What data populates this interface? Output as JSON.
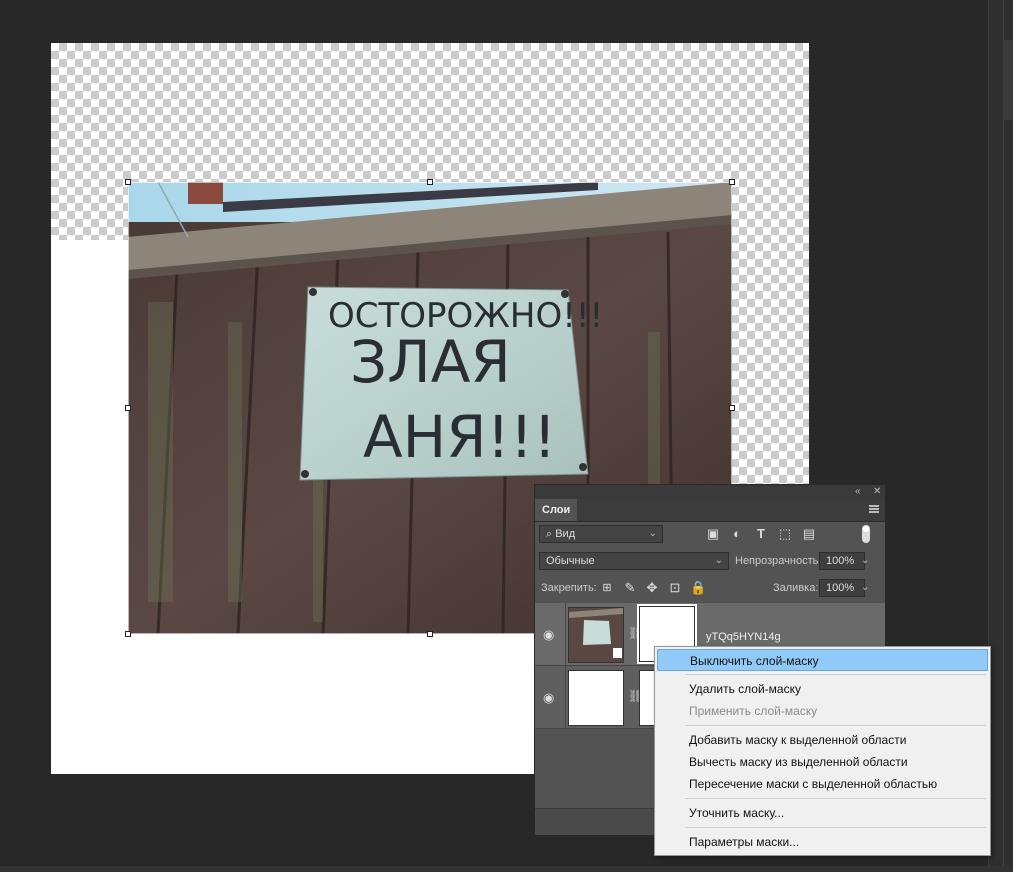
{
  "layers_panel": {
    "tab_label": "Слои",
    "filter": {
      "value": "Вид"
    },
    "blend_mode": "Обычные",
    "opacity_label": "Непрозрачность:",
    "opacity_value": "100%",
    "lock_label": "Закрепить:",
    "fill_label": "Заливка:",
    "fill_value": "100%",
    "layers": [
      {
        "name": "yTQq5HYN14g",
        "has_mask": true,
        "visible": true
      },
      {
        "name": "",
        "has_mask": true,
        "visible": true
      }
    ]
  },
  "photo_sign": {
    "line1": "ОСТОРОЖНО!!!",
    "line2": "ЗЛАЯ",
    "line3": "АНЯ!!!"
  },
  "context_menu": {
    "items": [
      {
        "label": "Выключить слой-маску",
        "state": "highlighted"
      },
      {
        "label": "Удалить слой-маску",
        "state": "normal"
      },
      {
        "label": "Применить слой-маску",
        "state": "disabled"
      },
      {
        "label": "Добавить маску к выделенной области",
        "state": "normal"
      },
      {
        "label": "Вычесть маску из выделенной области",
        "state": "normal"
      },
      {
        "label": "Пересечение маски с выделенной областью",
        "state": "normal"
      },
      {
        "label": "Уточнить маску...",
        "state": "normal"
      },
      {
        "label": "Параметры маски...",
        "state": "normal"
      }
    ]
  },
  "colors": {
    "workspace": "#282828",
    "panel": "#535353",
    "menu_highlight": "#91c9f7"
  }
}
